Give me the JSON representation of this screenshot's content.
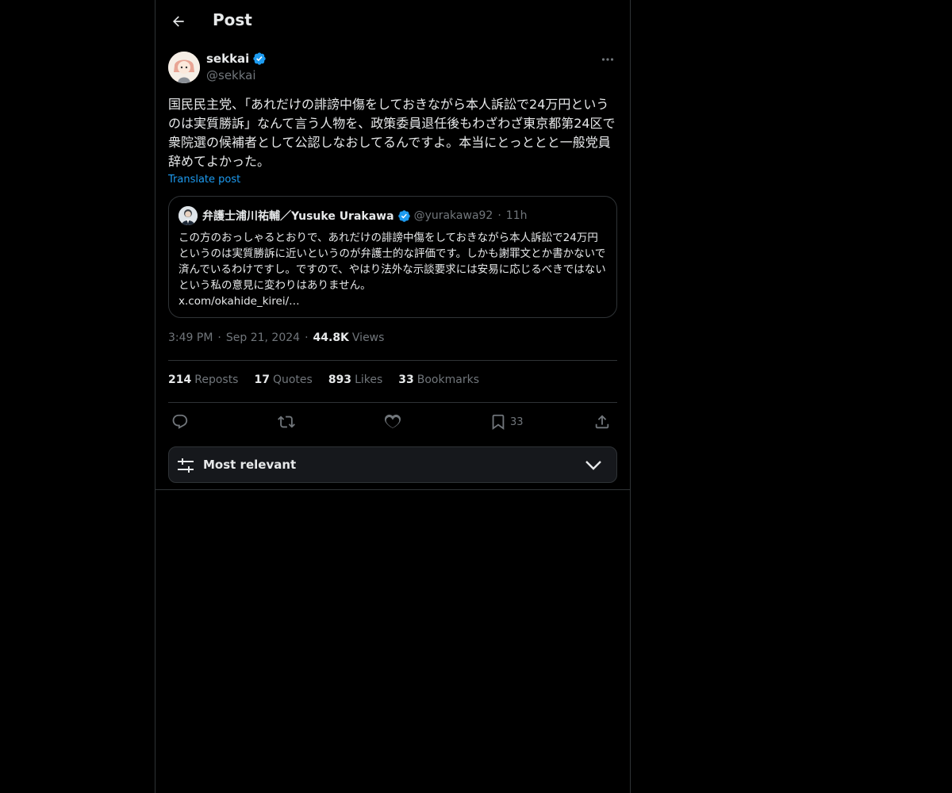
{
  "header": {
    "title": "Post",
    "back_icon": "arrow-left-icon"
  },
  "post": {
    "author_name": "sekkai",
    "author_handle": "@sekkai",
    "verified": true,
    "text": "国民民主党、「あれだけの誹謗中傷をしておきながら本人訴訟で24万円というのは実質勝訴」なんて言う人物を、政策委員退任後もわざわざ東京都第24区で衆院選の候補者として公認しなおしてるんですよ。本当にとっととと一般党員辞めてよかった。",
    "translate_label": "Translate post",
    "timestamp_time": "3:49 PM",
    "timestamp_date": "Sep 21, 2024",
    "views_count": "44.8K",
    "views_label": "Views"
  },
  "quote": {
    "author_name": "弁護士浦川祐輔／Yusuke Urakawa",
    "author_handle": "@yurakawa92",
    "verified": true,
    "time": "11h",
    "text": "この方のおっしゃるとおりで、あれだけの誹謗中傷をしておきながら本人訴訟で24万円というのは実質勝訴に近いというのが弁護士的な評価です。しかも謝罪文とか書かないで済んでいるわけですし。ですので、やはり法外な示談要求には安易に応じるべきではないという私の意見に変わりはありません。",
    "link": "x.com/okahide_kirei/…"
  },
  "stats": {
    "reposts_count": "214",
    "reposts_label": "Reposts",
    "quotes_count": "17",
    "quotes_label": "Quotes",
    "likes_count": "893",
    "likes_label": "Likes",
    "bookmarks_count": "33",
    "bookmarks_label": "Bookmarks"
  },
  "actions": {
    "bookmark_count": "33"
  },
  "sort": {
    "label": "Most relevant"
  },
  "colors": {
    "background": "#000000",
    "accent": "#1d9bf0",
    "text_primary": "#e7e9ea",
    "text_secondary": "#71767b",
    "border": "#2f3336"
  }
}
